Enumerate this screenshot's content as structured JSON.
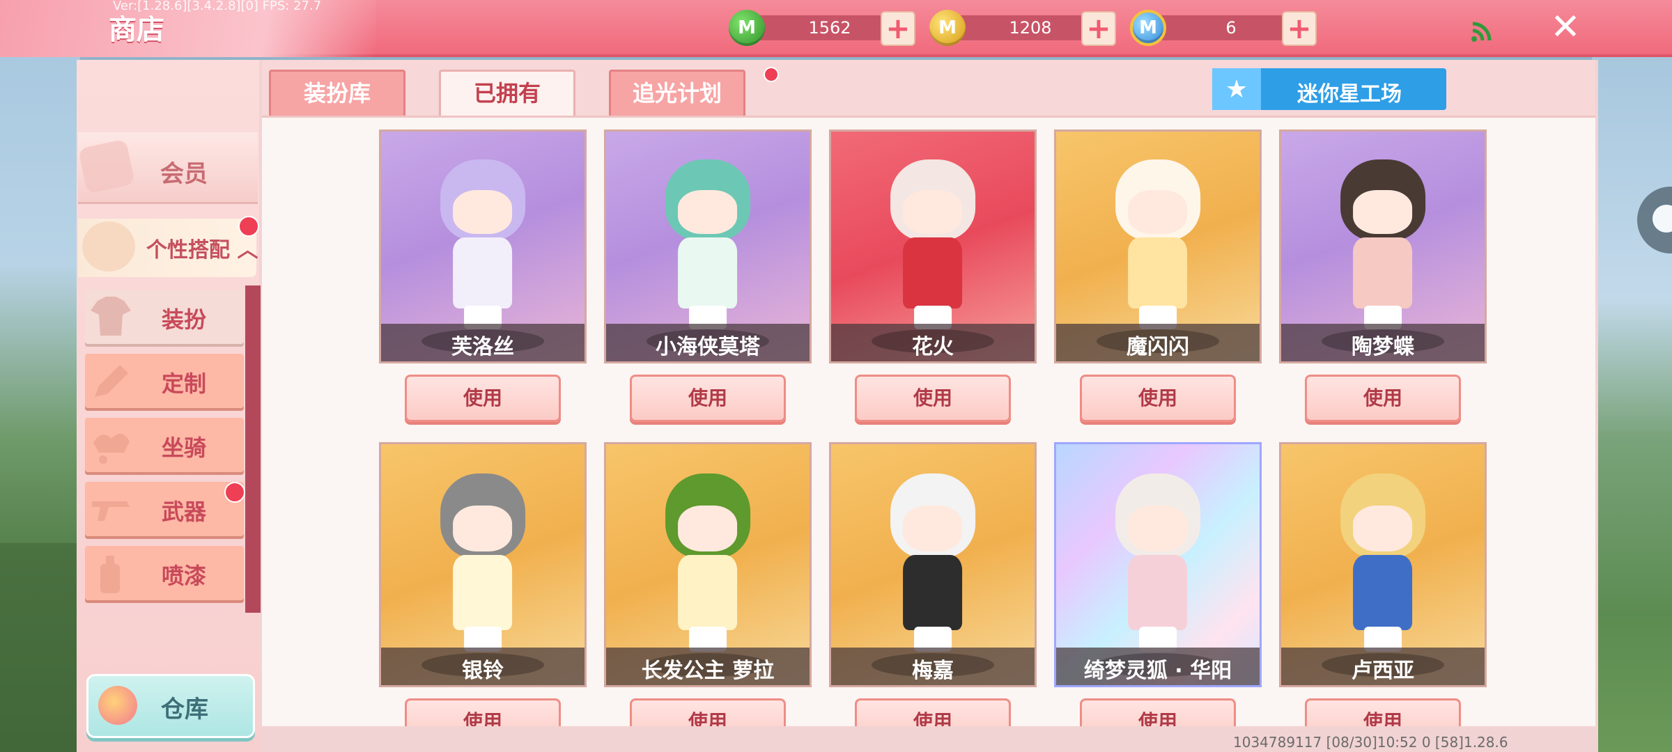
{
  "header": {
    "title": "商店",
    "debug_text": "Ver:[1.28.6][3.4.2.8][0] FPS: 27.7",
    "currencies": [
      {
        "name": "mini-bean",
        "value": "1562",
        "icon": "green-mini-coin-icon",
        "color": "#3fae35"
      },
      {
        "name": "mini-coin",
        "value": "1208",
        "icon": "gold-mini-coin-icon",
        "color": "#e8b21f"
      },
      {
        "name": "mini-point",
        "value": "6",
        "icon": "blue-mini-coin-icon",
        "color": "#3596e3"
      }
    ],
    "plus_label": "+",
    "close_label": "✕"
  },
  "sidebar": {
    "member_label": "会员",
    "expand_label": "个性搭配",
    "expand_arrow": "︿",
    "items": [
      {
        "label": "装扮",
        "active": true
      },
      {
        "label": "定制",
        "active": false
      },
      {
        "label": "坐骑",
        "active": false
      },
      {
        "label": "武器",
        "active": false,
        "badge": true
      },
      {
        "label": "喷漆",
        "active": false
      }
    ],
    "warehouse_label": "仓库"
  },
  "tabs": [
    {
      "label": "装扮库",
      "active": false
    },
    {
      "label": "已拥有",
      "active": true
    },
    {
      "label": "追光计划",
      "active": false,
      "badge": true
    }
  ],
  "studio_button": {
    "label": "迷你星工场",
    "icon": "star-icon"
  },
  "items": [
    {
      "name": "芙洛丝",
      "bg": "purple",
      "button": "使用"
    },
    {
      "name": "小海侠莫塔",
      "bg": "purple",
      "button": "使用"
    },
    {
      "name": "花火",
      "bg": "red",
      "button": "使用"
    },
    {
      "name": "魔闪闪",
      "bg": "orange",
      "button": "使用"
    },
    {
      "name": "陶梦蝶",
      "bg": "purple",
      "button": "使用"
    },
    {
      "name": "银铃",
      "bg": "orange",
      "button": "使用"
    },
    {
      "name": "长发公主 萝拉",
      "bg": "orange",
      "button": "使用"
    },
    {
      "name": "梅嘉",
      "bg": "orange",
      "button": "使用"
    },
    {
      "name": "绮梦灵狐 · 华阳",
      "bg": "rainbow",
      "button": "使用"
    },
    {
      "name": "卢西亚",
      "bg": "orange",
      "button": "使用"
    }
  ],
  "footer": {
    "text": "1034789117    [08/30]10:52 0  [58]1.28.6"
  }
}
